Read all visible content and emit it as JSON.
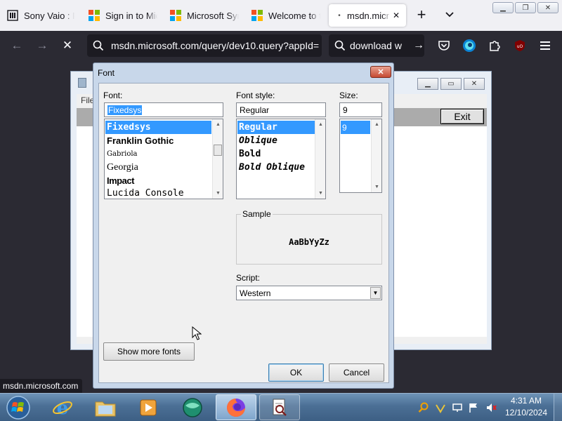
{
  "browser": {
    "tabs": [
      {
        "label": "Sony Vaio : Fr",
        "icon": "library-icon"
      },
      {
        "label": "Sign in to Mic",
        "icon": "microsoft-logo-icon"
      },
      {
        "label": "Microsoft Syn",
        "icon": "microsoft-logo-icon"
      },
      {
        "label": "Welcome to t",
        "icon": "microsoft-logo-icon"
      },
      {
        "label": "msdn.micr",
        "icon": "loading-dot-icon",
        "active": true
      }
    ],
    "new_tab_symbol": "+",
    "tab_list_symbol": "⌄",
    "close_tab_symbol": "✕",
    "address": "msdn.microsoft.com/query/dev10.query?appId=",
    "search_text": "download w",
    "status_url": "msdn.microsoft.com",
    "colors": {
      "chrome_dark": "#2b2a33",
      "tabbar": "#f0f0f4",
      "ms_red": "#f25022",
      "ms_green": "#7fba00",
      "ms_blue": "#00a4ef",
      "ms_yellow": "#ffb900"
    }
  },
  "app_window": {
    "menu_text": "File",
    "exit_label": "Exit"
  },
  "font_dialog": {
    "title": "Font",
    "font": {
      "label": "Font:",
      "value": "Fixedsys",
      "items": [
        {
          "name": "Fixedsys",
          "selected": true
        },
        {
          "name": "Franklin Gothic"
        },
        {
          "name": "Gabriola"
        },
        {
          "name": "Georgia"
        },
        {
          "name": "Impact"
        },
        {
          "name": "Lucida Console"
        }
      ]
    },
    "style": {
      "label": "Font style:",
      "value": "Regular",
      "items": [
        {
          "name": "Regular",
          "selected": true
        },
        {
          "name": "Oblique"
        },
        {
          "name": "Bold"
        },
        {
          "name": "Bold Oblique"
        }
      ]
    },
    "size": {
      "label": "Size:",
      "value": "9",
      "items": [
        {
          "name": "9",
          "selected": true
        }
      ]
    },
    "sample": {
      "label": "Sample",
      "text": "AaBbYyZz"
    },
    "script": {
      "label": "Script:",
      "value": "Western"
    },
    "show_more_label": "Show more fonts",
    "ok_label": "OK",
    "cancel_label": "Cancel",
    "selection_color": "#3399ff"
  },
  "taskbar": {
    "apps": [
      {
        "name": "internet-explorer",
        "icon": "ie-icon"
      },
      {
        "name": "file-explorer",
        "icon": "folder-icon"
      },
      {
        "name": "media-player",
        "icon": "media-player-icon"
      },
      {
        "name": "app",
        "icon": "globe-app-icon"
      },
      {
        "name": "firefox",
        "icon": "firefox-icon",
        "active": true
      },
      {
        "name": "font-app",
        "icon": "document-magnifier-icon",
        "open": true
      }
    ],
    "time": "4:31 AM",
    "date": "12/10/2024"
  }
}
